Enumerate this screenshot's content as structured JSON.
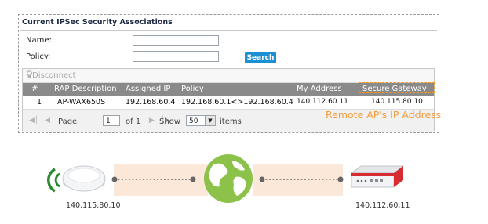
{
  "panel": {
    "title": "Current IPSec Security Associations",
    "name_label": "Name:",
    "name_value": "",
    "policy_label": "Policy:",
    "policy_value": "",
    "search_label": "Search"
  },
  "toolbar": {
    "disconnect_label": "Disconnect"
  },
  "table": {
    "headers": [
      "#",
      "RAP Description",
      "Assigned IP",
      "Policy",
      "My Address",
      "Secure Gateway"
    ],
    "rows": [
      [
        "1",
        "AP-WAX650S",
        "192.168.60.4",
        "192.168.60.1<>192.168.60.4",
        "140.112.60.11",
        "140.115.80.10"
      ]
    ]
  },
  "pager": {
    "page_label": "Page",
    "page_value": "1",
    "of_label": "of 1",
    "show_label": "Show",
    "show_value": "50",
    "items_label": "items"
  },
  "annotation": {
    "remote_ap_text": "Remote AP's IP Address"
  },
  "diagram": {
    "left_ip": "140.115.80.10",
    "right_ip": "140.112.60.11"
  },
  "colors": {
    "accent_orange": "#f39a3a",
    "search_blue": "#1d8fd4",
    "tunnel_band": "#fce8d8",
    "globe_green": "#8cc24a",
    "wifi_green": "#2d8a33",
    "device_red": "#d62b30"
  }
}
